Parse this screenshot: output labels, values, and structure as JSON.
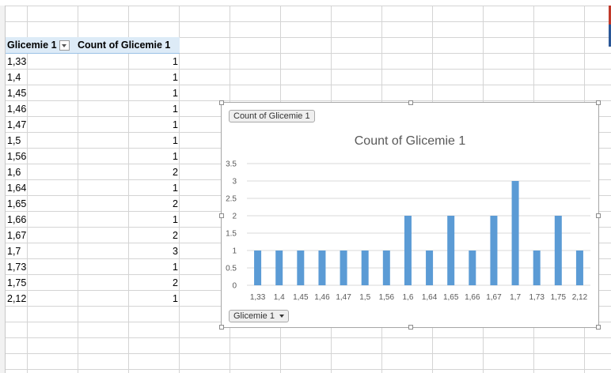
{
  "pivot_table": {
    "header": {
      "row_label": "Glicemie 1",
      "value_label": "Count of Glicemie 1"
    },
    "rows": [
      {
        "label": "1,33",
        "count": "1"
      },
      {
        "label": "1,4",
        "count": "1"
      },
      {
        "label": "1,45",
        "count": "1"
      },
      {
        "label": "1,46",
        "count": "1"
      },
      {
        "label": "1,47",
        "count": "1"
      },
      {
        "label": "1,5",
        "count": "1"
      },
      {
        "label": "1,56",
        "count": "1"
      },
      {
        "label": "1,6",
        "count": "2"
      },
      {
        "label": "1,64",
        "count": "1"
      },
      {
        "label": "1,65",
        "count": "2"
      },
      {
        "label": "1,66",
        "count": "1"
      },
      {
        "label": "1,67",
        "count": "2"
      },
      {
        "label": "1,7",
        "count": "3"
      },
      {
        "label": "1,73",
        "count": "1"
      },
      {
        "label": "1,75",
        "count": "2"
      },
      {
        "label": "2,12",
        "count": "1"
      }
    ]
  },
  "chart": {
    "value_field_button": "Count of Glicemie 1",
    "axis_field_button": "Glicemie 1"
  },
  "colors": {
    "bar": "#5b9bd5",
    "header_fill": "#ddebf7",
    "grid": "#d9d9d9"
  },
  "chart_data": {
    "type": "bar",
    "title": "Count of Glicemie 1",
    "categories": [
      "1,33",
      "1,4",
      "1,45",
      "1,46",
      "1,47",
      "1,5",
      "1,56",
      "1,6",
      "1,64",
      "1,65",
      "1,66",
      "1,67",
      "1,7",
      "1,73",
      "1,75",
      "2,12"
    ],
    "values": [
      1,
      1,
      1,
      1,
      1,
      1,
      1,
      2,
      1,
      2,
      1,
      2,
      3,
      1,
      2,
      1
    ],
    "ylim": [
      0,
      3.5
    ],
    "yticks": [
      "0",
      "0.5",
      "1",
      "1.5",
      "2",
      "2.5",
      "3",
      "3.5"
    ],
    "ytick_values": [
      0,
      0.5,
      1,
      1.5,
      2,
      2.5,
      3,
      3.5
    ],
    "grid": true,
    "legend": "none"
  }
}
